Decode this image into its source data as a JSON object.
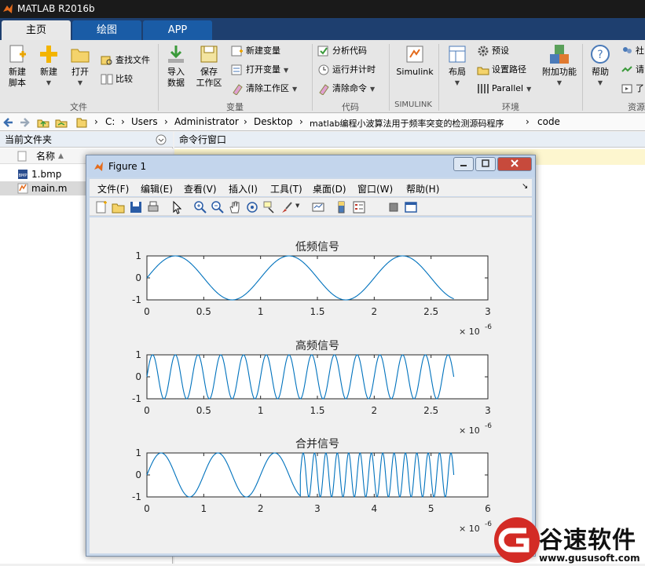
{
  "app": {
    "title": "MATLAB R2016b"
  },
  "tabs": [
    "主页",
    "绘图",
    "APP"
  ],
  "ribbon": {
    "file": {
      "new_script": [
        "新建",
        "脚本"
      ],
      "new": "新建",
      "open": "打开",
      "find_files": "查找文件",
      "compare": "比较",
      "group": "文件"
    },
    "variable": {
      "import": [
        "导入",
        "数据"
      ],
      "save_ws": [
        "保存",
        "工作区"
      ],
      "new_var": "新建变量",
      "open_var": "打开变量",
      "clear_ws": "清除工作区",
      "group": "变量"
    },
    "code": {
      "analyze": "分析代码",
      "run_time": "运行并计时",
      "clear_cmds": "清除命令",
      "group": "代码"
    },
    "simulink": {
      "label": "Simulink",
      "group": "SIMULINK"
    },
    "env": {
      "layout": "布局",
      "prefs": "预设",
      "set_path": "设置路径",
      "parallel": "Parallel",
      "addons": "附加功能",
      "group": "环境"
    },
    "resources": {
      "help": "帮助",
      "r1": "社",
      "r2": "请",
      "r3": "了",
      "group": "资源"
    }
  },
  "address": {
    "path": [
      "C:",
      "Users",
      "Administrator",
      "Desktop",
      "matlab编程小波算法用于频率突变的检测源码程序",
      "code"
    ]
  },
  "current_folder": {
    "title": "当前文件夹",
    "column_name": "名称",
    "files": [
      {
        "name": "1.bmp",
        "icon": "bmp-file-icon"
      },
      {
        "name": "main.m",
        "icon": "m-file-icon"
      }
    ]
  },
  "command_window": {
    "title": "命令行窗口"
  },
  "figure": {
    "title": "Figure 1",
    "menu": [
      "文件(F)",
      "编辑(E)",
      "查看(V)",
      "插入(I)",
      "工具(T)",
      "桌面(D)",
      "窗口(W)",
      "帮助(H)"
    ],
    "menu_arrow": "↘"
  },
  "chart_data": [
    {
      "type": "line",
      "title": "低频信号",
      "xlim": [
        0,
        3
      ],
      "ylim": [
        -1,
        1
      ],
      "xticks": [
        "0",
        "0.5",
        "1",
        "1.5",
        "2",
        "2.5",
        "3"
      ],
      "yticks": [
        "1",
        "0",
        "-1"
      ],
      "exponent_base": "× 10",
      "exponent_power": "-6",
      "series": [
        {
          "function": "sin",
          "cycles_per_unit": 1,
          "x_end": 2.7
        }
      ],
      "color": "#0072bd"
    },
    {
      "type": "line",
      "title": "高频信号",
      "xlim": [
        0,
        3
      ],
      "ylim": [
        -1,
        1
      ],
      "xticks": [
        "0",
        "0.5",
        "1",
        "1.5",
        "2",
        "2.5",
        "3"
      ],
      "yticks": [
        "1",
        "0",
        "-1"
      ],
      "exponent_base": "× 10",
      "exponent_power": "-6",
      "series": [
        {
          "function": "sin",
          "cycles_per_unit": 5,
          "x_end": 2.7
        }
      ],
      "color": "#0072bd"
    },
    {
      "type": "line",
      "title": "合并信号",
      "xlim": [
        0,
        6
      ],
      "ylim": [
        -1,
        1
      ],
      "xticks": [
        "0",
        "1",
        "2",
        "3",
        "4",
        "5",
        "6"
      ],
      "yticks": [
        "1",
        "0",
        "-1"
      ],
      "exponent_base": "× 10",
      "exponent_power": "-6",
      "series": [
        {
          "function": "sin",
          "cycles_per_unit": 1,
          "x_start": 0,
          "x_end": 2.7
        },
        {
          "function": "sin",
          "cycles_per_unit": 5,
          "x_start": 2.7,
          "x_end": 5.4
        }
      ],
      "color": "#0072bd"
    }
  ],
  "watermark": {
    "text": "谷速软件",
    "url": "www.gususoft.com"
  }
}
